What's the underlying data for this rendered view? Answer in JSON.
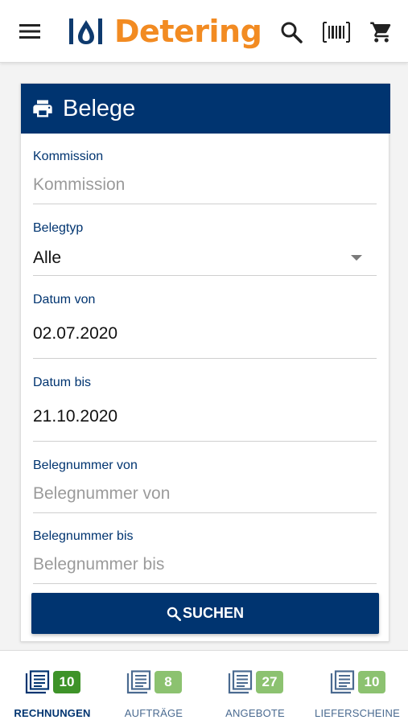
{
  "header": {
    "brand_name": "Detering",
    "brand_color": "#f28b22",
    "menu_icon": "hamburger-menu-icon",
    "search_icon": "search-icon",
    "barcode_icon": "barcode-scanner-icon",
    "cart_icon": "shopping-cart-icon"
  },
  "card": {
    "title": "Belege",
    "title_icon": "printer-icon",
    "header_color": "#003470",
    "fields": {
      "kommission": {
        "label": "Kommission",
        "placeholder": "Kommission",
        "value": ""
      },
      "belegtyp": {
        "label": "Belegtyp",
        "value": "Alle"
      },
      "datum_von": {
        "label": "Datum von",
        "value": "02.07.2020"
      },
      "datum_bis": {
        "label": "Datum bis",
        "value": "21.10.2020"
      },
      "belegnummer_von": {
        "label": "Belegnummer von",
        "placeholder": "Belegnummer von",
        "value": ""
      },
      "belegnummer_bis": {
        "label": "Belegnummer bis",
        "placeholder": "Belegnummer bis",
        "value": ""
      }
    },
    "search_button": {
      "label": "SUCHEN",
      "icon": "search-icon"
    }
  },
  "bottom_nav": {
    "items": [
      {
        "label": "RECHNUNGEN",
        "count": "10",
        "icon": "document-list-icon",
        "active": true
      },
      {
        "label": "AUFTRÄGE",
        "count": "8",
        "icon": "document-list-icon",
        "active": false
      },
      {
        "label": "ANGEBOTE",
        "count": "27",
        "icon": "document-list-icon",
        "active": false
      },
      {
        "label": "LIEFERSCHEINE",
        "count": "10",
        "icon": "document-list-icon",
        "active": false
      }
    ],
    "active_badge_color": "#3e9329",
    "badge_color": "#8cc270"
  }
}
